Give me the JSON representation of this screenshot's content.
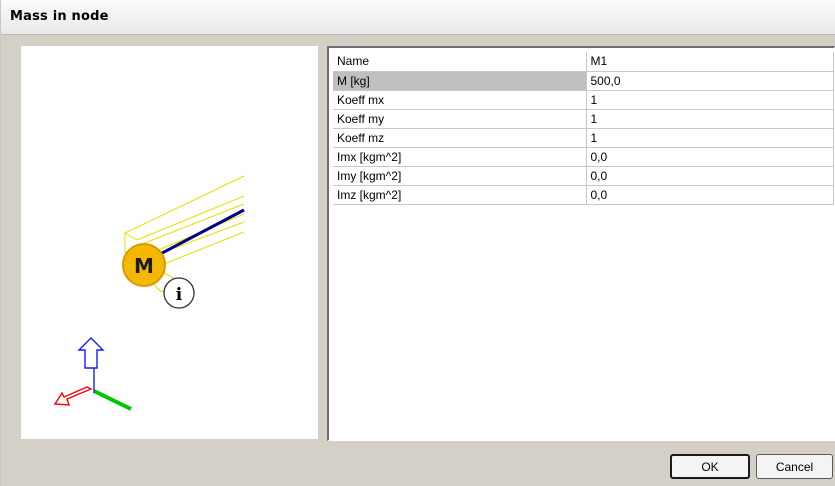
{
  "window": {
    "title": "Mass in node"
  },
  "preview": {
    "mass_label": "M",
    "node_label": "i",
    "axis_colors": {
      "x": "#ff0000",
      "y": "#00c800",
      "z": "#1a1aff"
    },
    "beam_color": "#00008b",
    "wire_color": "#e6e000",
    "mass_color": "#f5b800"
  },
  "properties": [
    {
      "name": "Name",
      "value": "M1"
    },
    {
      "name": "M [kg]",
      "value": "500,0"
    },
    {
      "name": "Koeff mx",
      "value": "1"
    },
    {
      "name": "Koeff my",
      "value": "1"
    },
    {
      "name": "Koeff mz",
      "value": "1"
    },
    {
      "name": "Imx [kgm^2]",
      "value": "0,0"
    },
    {
      "name": "Imy [kgm^2]",
      "value": "0,0"
    },
    {
      "name": "Imz [kgm^2]",
      "value": "0,0"
    }
  ],
  "buttons": {
    "ok": "OK",
    "cancel": "Cancel"
  }
}
